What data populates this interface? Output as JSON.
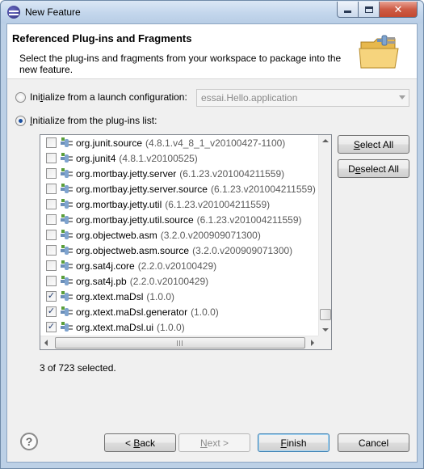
{
  "window": {
    "title": "New Feature",
    "controls": {
      "close_glyph": "✕"
    }
  },
  "banner": {
    "title": "Referenced Plug-ins and Fragments",
    "description": "Select the plug-ins and fragments from your workspace to package into the new feature.",
    "icon": "folder-plug-icon"
  },
  "options": {
    "launch_config_label": "Initialize from a launch configuration:",
    "launch_config_mnemonic": "t",
    "launch_config_selected": false,
    "launch_config_value": "essai.Hello.application",
    "plugins_list_label": "Initialize from the plug-ins list:",
    "plugins_list_mnemonic": "I",
    "plugins_list_selected": true
  },
  "plugins": [
    {
      "name": "org.junit.source",
      "version": "(4.8.1.v4_8_1_v20100427-1100)",
      "checked": false
    },
    {
      "name": "org.junit4",
      "version": "(4.8.1.v20100525)",
      "checked": false
    },
    {
      "name": "org.mortbay.jetty.server",
      "version": "(6.1.23.v201004211559)",
      "checked": false
    },
    {
      "name": "org.mortbay.jetty.server.source",
      "version": "(6.1.23.v201004211559)",
      "checked": false
    },
    {
      "name": "org.mortbay.jetty.util",
      "version": "(6.1.23.v201004211559)",
      "checked": false
    },
    {
      "name": "org.mortbay.jetty.util.source",
      "version": "(6.1.23.v201004211559)",
      "checked": false
    },
    {
      "name": "org.objectweb.asm",
      "version": "(3.2.0.v200909071300)",
      "checked": false
    },
    {
      "name": "org.objectweb.asm.source",
      "version": "(3.2.0.v200909071300)",
      "checked": false
    },
    {
      "name": "org.sat4j.core",
      "version": "(2.2.0.v20100429)",
      "checked": false
    },
    {
      "name": "org.sat4j.pb",
      "version": "(2.2.0.v20100429)",
      "checked": false
    },
    {
      "name": "org.xtext.maDsl",
      "version": "(1.0.0)",
      "checked": true
    },
    {
      "name": "org.xtext.maDsl.generator",
      "version": "(1.0.0)",
      "checked": true
    },
    {
      "name": "org.xtext.maDsl.ui",
      "version": "(1.0.0)",
      "checked": true
    }
  ],
  "list_buttons": {
    "select_all": "Select All",
    "deselect_all": "Deselect All"
  },
  "status": "3 of 723 selected.",
  "footer": {
    "help_glyph": "?",
    "back": "< Back",
    "next": "Next >",
    "finish": "Finish",
    "cancel": "Cancel"
  },
  "colors": {
    "check_mark": "#263e6f",
    "default_button_border": "#3c7fb1"
  }
}
